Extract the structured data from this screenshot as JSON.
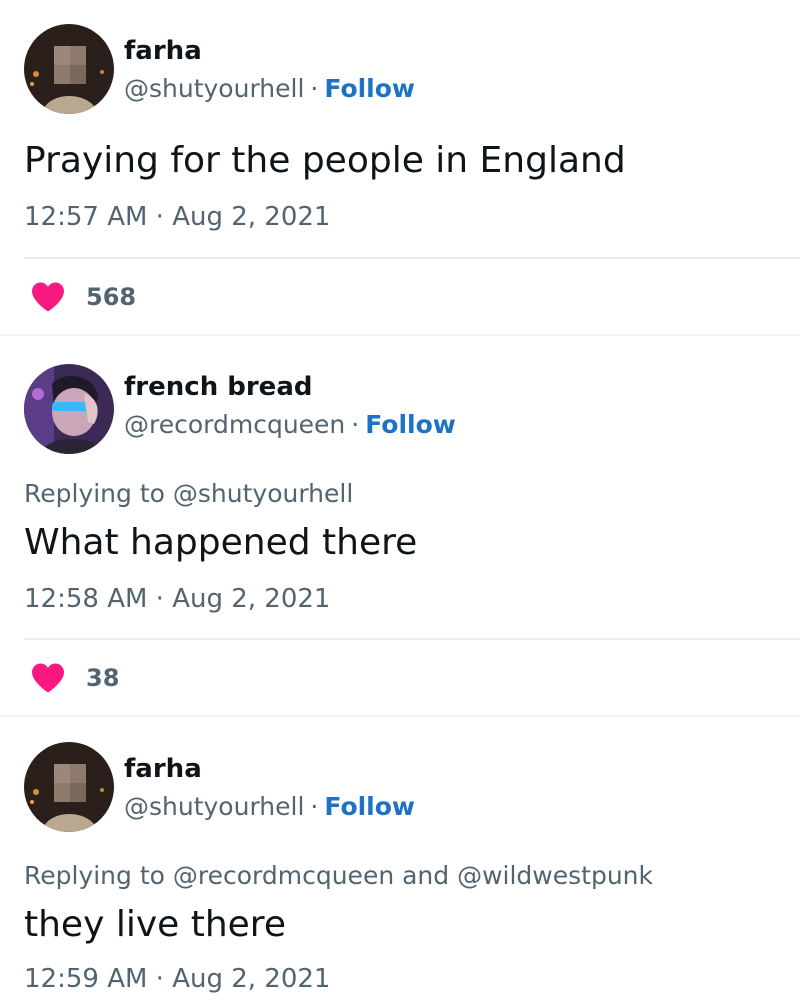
{
  "tweets": [
    {
      "name": "farha",
      "handle": "@shutyourhell",
      "separator": "·",
      "follow": "Follow",
      "replying": "",
      "text": "Praying for the people in England",
      "timestamp": "12:57 AM · Aug 2, 2021",
      "likes": "568"
    },
    {
      "name": "french bread",
      "handle": "@recordmcqueen",
      "separator": "·",
      "follow": "Follow",
      "replying": "Replying to @shutyourhell",
      "text": "What happened there",
      "timestamp": "12:58 AM · Aug 2, 2021",
      "likes": "38"
    },
    {
      "name": "farha",
      "handle": "@shutyourhell",
      "separator": "·",
      "follow": "Follow",
      "replying": "Replying to @recordmcqueen and @wildwestpunk",
      "text": "they live there",
      "timestamp": "12:59 AM · Aug 2, 2021"
    }
  ],
  "icons": {
    "like": "heart-icon"
  },
  "colors": {
    "heart": "#f91880",
    "follow": "#1d72c4",
    "muted": "#536471",
    "text": "#0f1419"
  }
}
